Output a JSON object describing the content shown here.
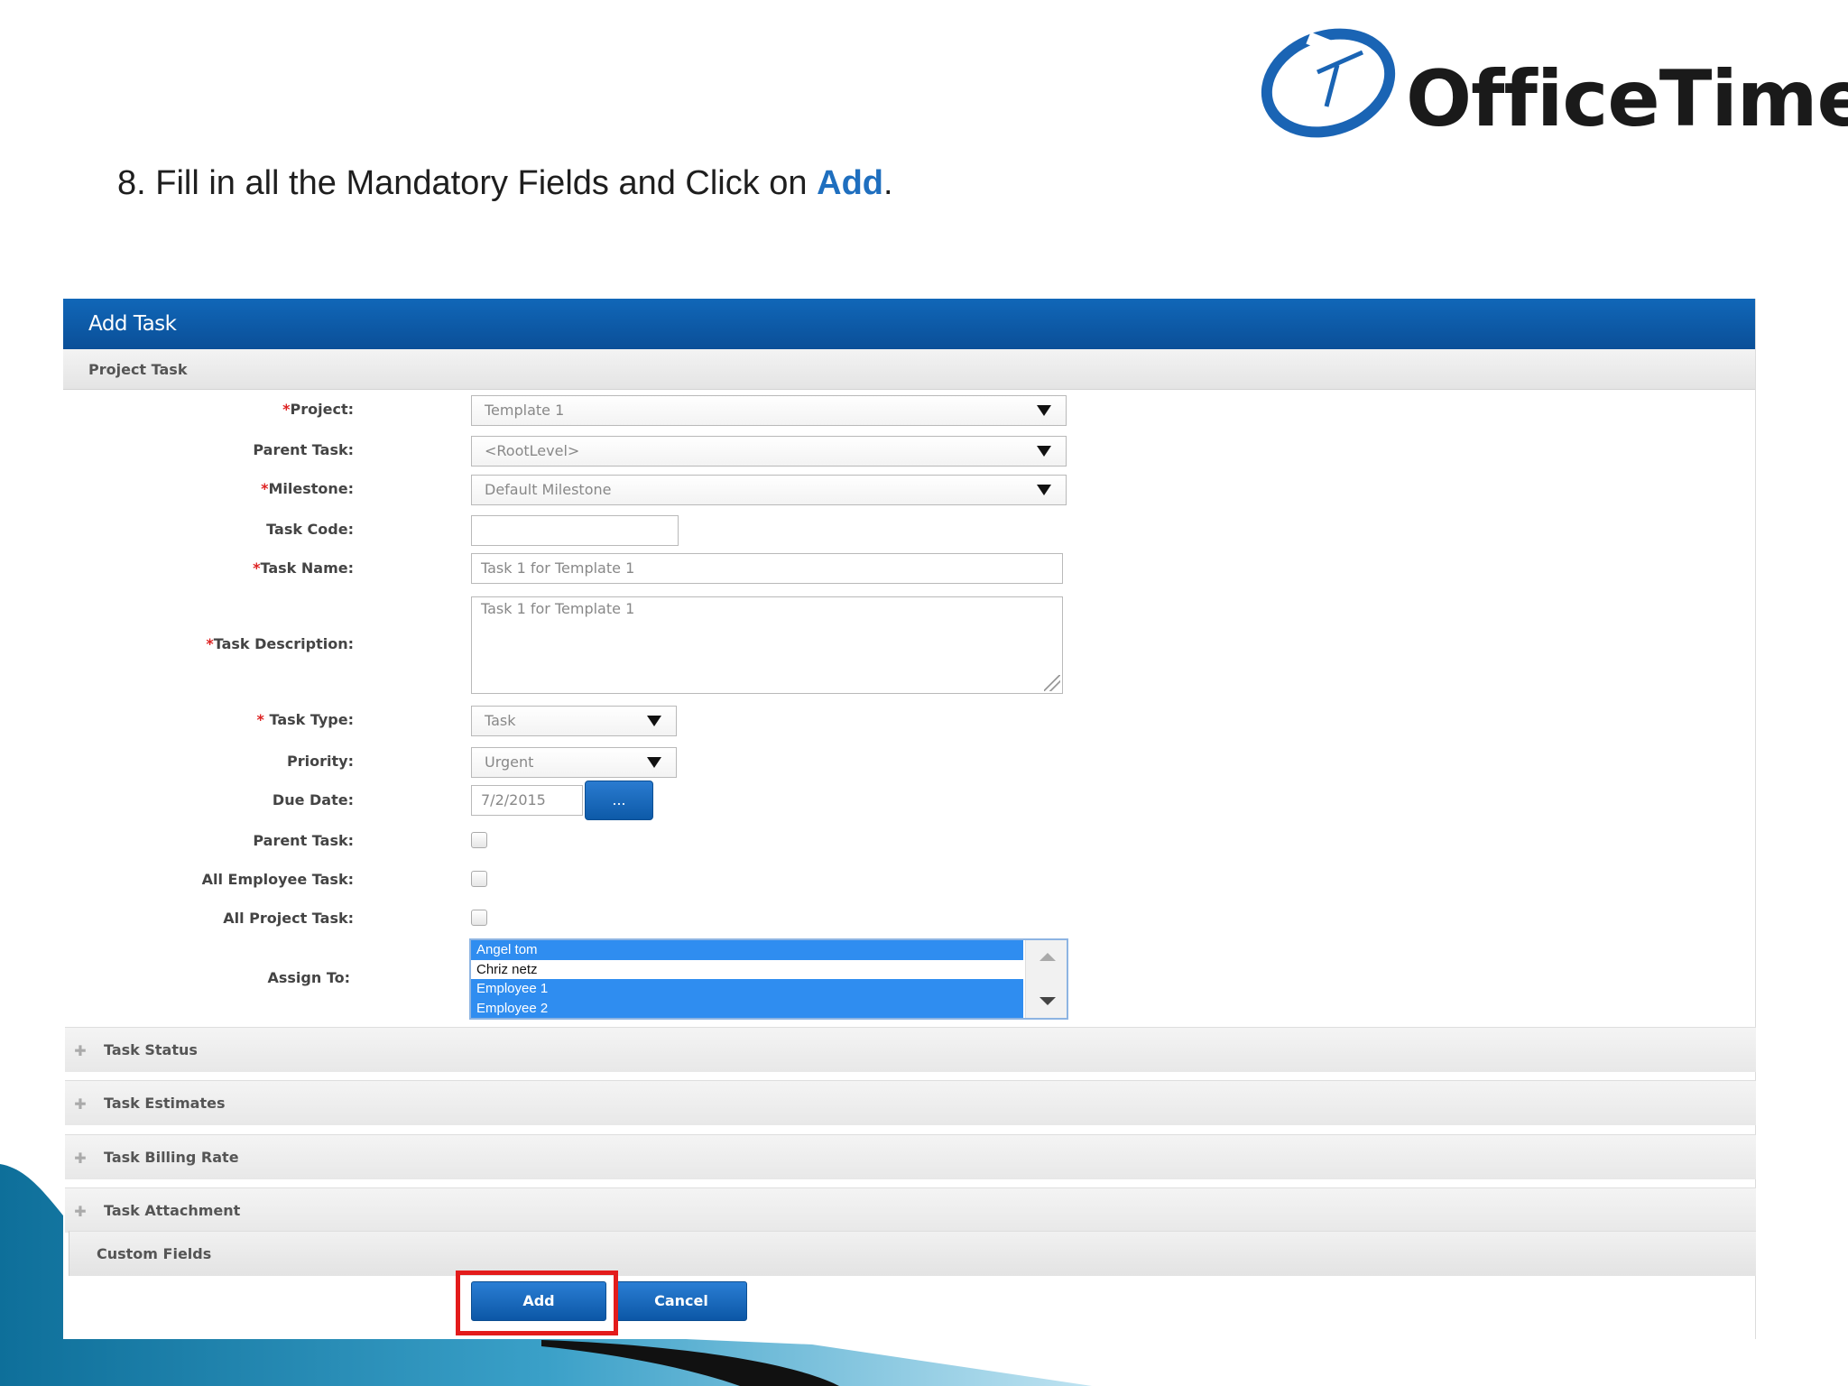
{
  "slide": {
    "logo_text": "OfficeTimer",
    "instruction_prefix": "8. Fill in all the Mandatory Fields and Click on ",
    "instruction_highlight": "Add",
    "instruction_suffix": "."
  },
  "panel": {
    "title": "Add Task",
    "subtitle": "Project Task"
  },
  "form": {
    "project": {
      "required": "*",
      "label": "Project:",
      "value": "Template 1"
    },
    "parent_task_select": {
      "label": "Parent Task:",
      "value": "<RootLevel>"
    },
    "milestone": {
      "required": "*",
      "label": "Milestone:",
      "value": "Default Milestone"
    },
    "task_code": {
      "label": "Task Code:",
      "value": ""
    },
    "task_name": {
      "required": "*",
      "label": "Task Name:",
      "value": "Task 1 for Template 1"
    },
    "task_description": {
      "required": "*",
      "label": "Task Description:",
      "value": "Task 1 for Template 1"
    },
    "task_type": {
      "required": "*",
      "label": " Task Type:",
      "value": "Task"
    },
    "priority": {
      "label": "Priority:",
      "value": "Urgent"
    },
    "due_date": {
      "label": "Due Date:",
      "value": "7/2/2015",
      "button_label": "..."
    },
    "parent_task_checkbox": {
      "label": "Parent Task:",
      "checked": false
    },
    "all_employee_task": {
      "label": "All Employee Task:",
      "checked": false
    },
    "all_project_task": {
      "label": "All Project Task:",
      "checked": false
    },
    "assign_to": {
      "label": "Assign To:",
      "options": [
        {
          "name": "Angel tom",
          "selected": true
        },
        {
          "name": "Chriz netz",
          "selected": false
        },
        {
          "name": "Employee 1",
          "selected": true
        },
        {
          "name": "Employee 2",
          "selected": true
        }
      ]
    }
  },
  "sections": {
    "task_status": "Task Status",
    "task_estimates": "Task Estimates",
    "task_billing_rate": "Task Billing Rate",
    "task_attachment": "Task Attachment",
    "custom_fields": "Custom Fields"
  },
  "actions": {
    "add_label": "Add",
    "cancel_label": "Cancel"
  },
  "colors": {
    "header_blue": "#0a5aa8",
    "highlight_red": "#e31b1b",
    "selection_blue": "#2f8df0"
  }
}
